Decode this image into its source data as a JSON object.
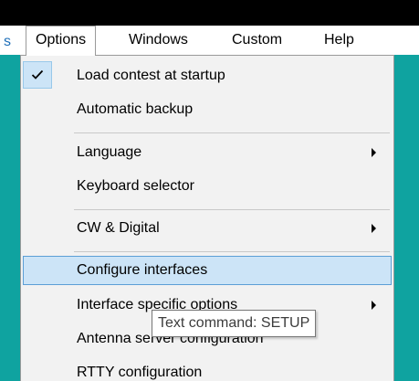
{
  "menubar": {
    "items": [
      {
        "label": "Options"
      },
      {
        "label": "Windows"
      },
      {
        "label": "Custom"
      },
      {
        "label": "Help"
      }
    ]
  },
  "menu": {
    "items": [
      {
        "label": "Load contest at startup",
        "checked": true
      },
      {
        "label": "Automatic backup"
      },
      {
        "label": "Language",
        "submenu": true
      },
      {
        "label": "Keyboard selector"
      },
      {
        "label": "CW & Digital",
        "submenu": true
      },
      {
        "label": "Configure interfaces",
        "highlighted": true
      },
      {
        "label": "Interface specific options",
        "submenu": true
      },
      {
        "label": "Antenna server configuration"
      },
      {
        "label": "RTTY configuration"
      }
    ]
  },
  "tooltip": {
    "text": "Text command: SETUP"
  },
  "colors": {
    "background": "#0fa3a0",
    "menu_background": "#f2f2f2",
    "highlight": "#cce4f7",
    "highlight_border": "#5c9fd6"
  },
  "icons": {
    "checkmark": "checkmark-icon",
    "submenu": "chevron-right-icon"
  }
}
